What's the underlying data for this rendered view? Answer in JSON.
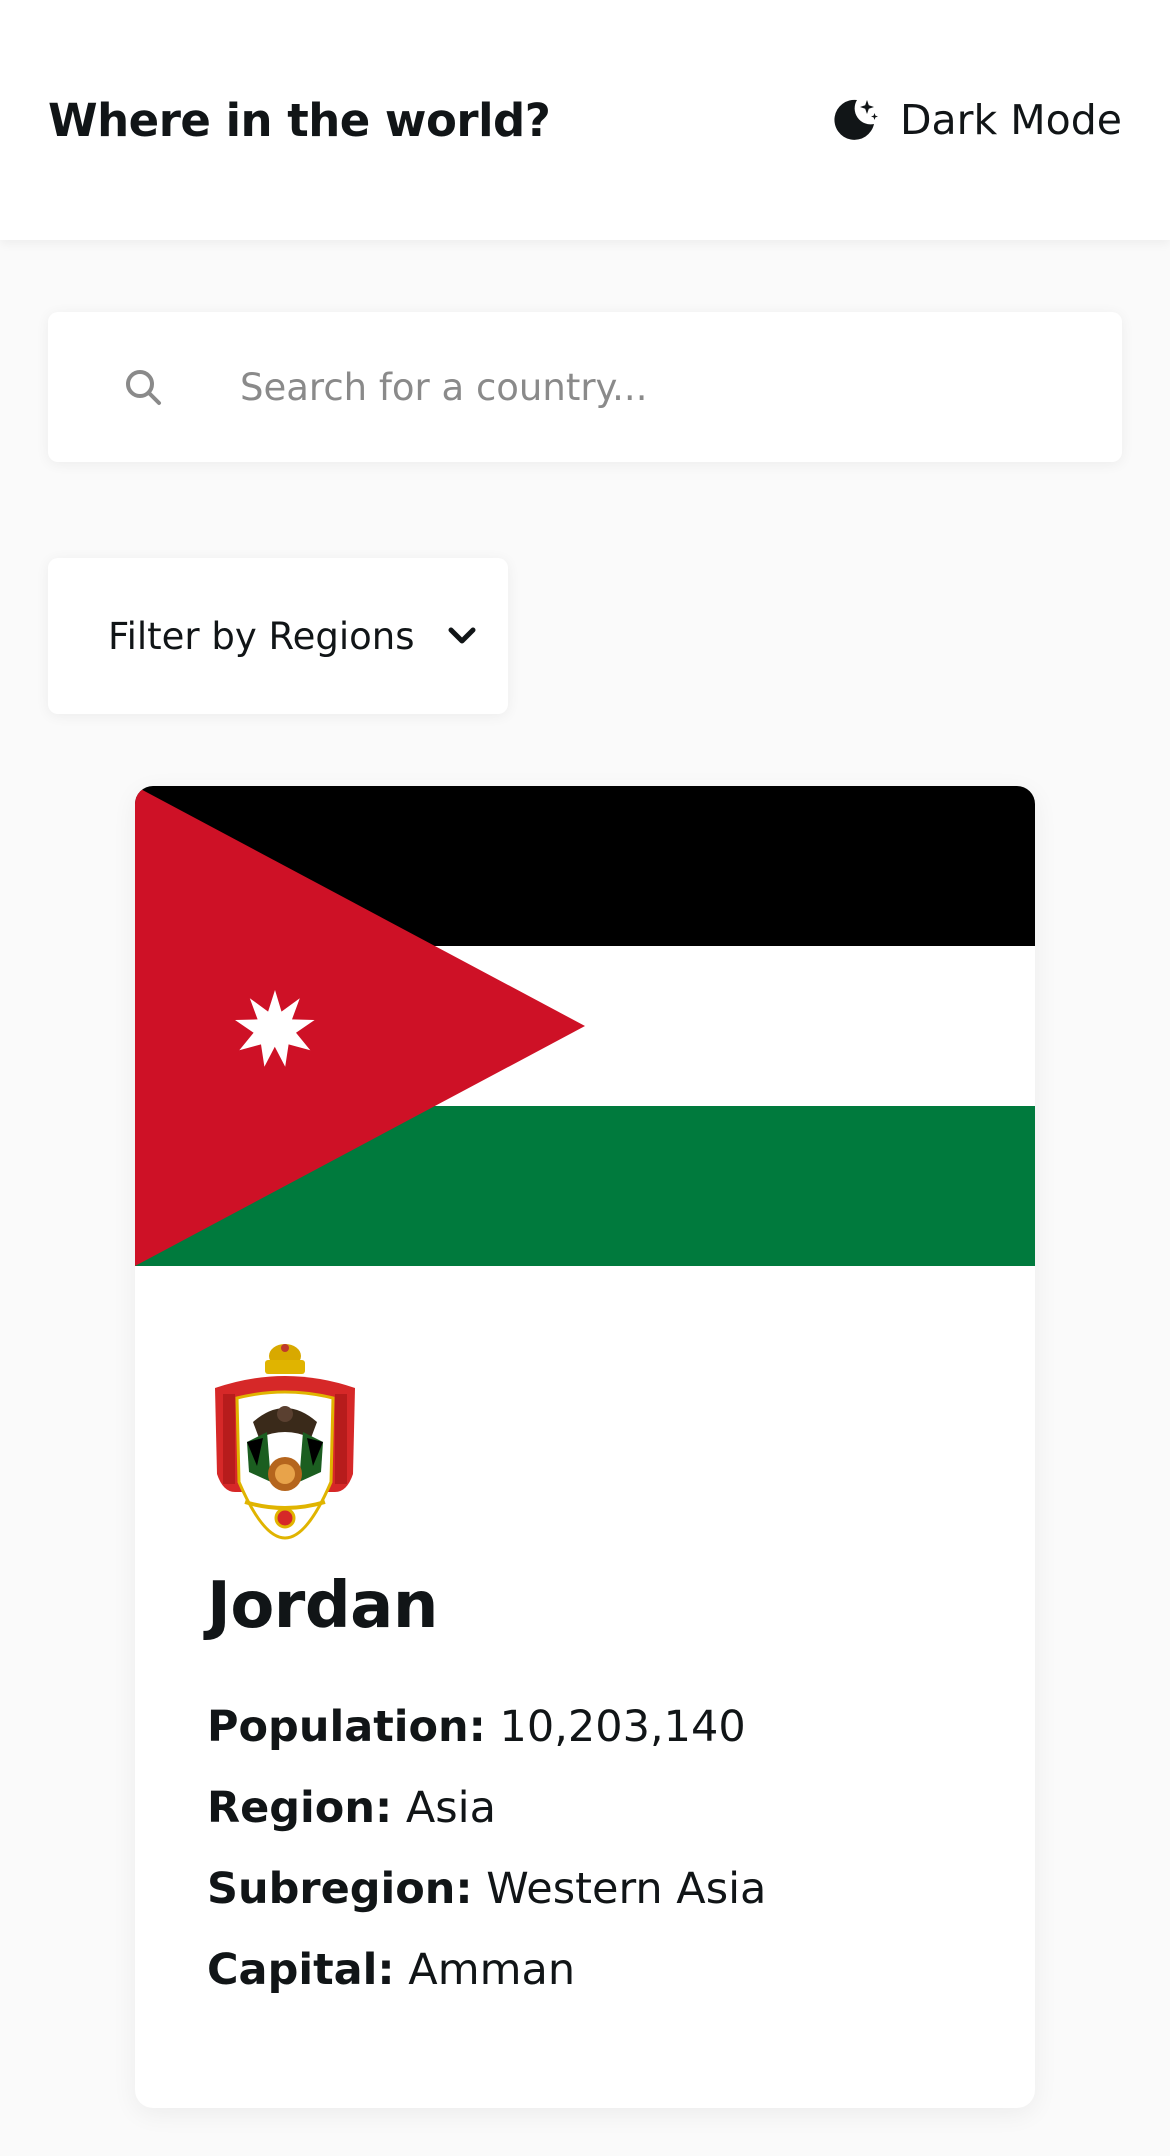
{
  "header": {
    "title": "Where in the world?",
    "theme_toggle_label": "Dark Mode",
    "theme_toggle_icon": "moon-stars-icon"
  },
  "search": {
    "icon": "search-icon",
    "placeholder": "Search for a country...",
    "value": ""
  },
  "filter": {
    "selected_label": "Filter by Regions",
    "icon": "chevron-down-icon"
  },
  "country_card": {
    "flag_image": "flag-jordan",
    "coat_of_arms_image": "coat-of-arms-jordan",
    "name": "Jordan",
    "facts": [
      {
        "label": "Population:",
        "value": "10,203,140"
      },
      {
        "label": "Region:",
        "value": "Asia"
      },
      {
        "label": "Subregion:",
        "value": "Western Asia"
      },
      {
        "label": "Capital:",
        "value": "Amman"
      }
    ]
  },
  "colors": {
    "background": "#fafafa",
    "surface": "#ffffff",
    "text": "#111517",
    "placeholder": "#8a8a8a",
    "flag_black": "#000000",
    "flag_white": "#ffffff",
    "flag_green": "#007a3d",
    "flag_red": "#ce1126"
  }
}
